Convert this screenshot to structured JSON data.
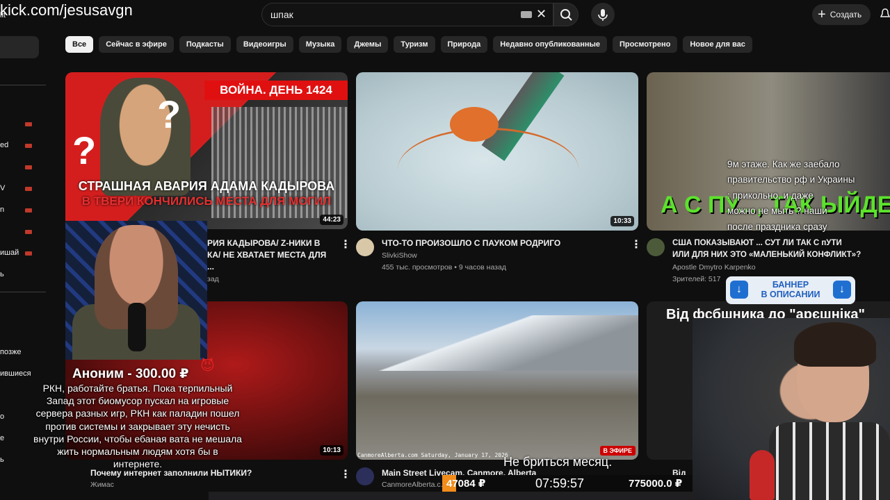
{
  "overlay": {
    "channel_url": "kick.com/jesusavgn",
    "donation_name": "Аноним - 300.00 ₽",
    "donation_text": "РКН, работайте братья. Пока терпильный Запад этот биомусор пускал на игровые сервера разных игр, РКН как паладин пошел против системы и закрывает эту нечисть внутри России, чтобы ебаная вата не мешала жить нормальным людям хотя бы в интернете.",
    "chat_lines": [
      "9м этаже. Как же заебало",
      "правительство рф и Украины",
      ": прикольно, и даже",
      "можно не мыть ? наши",
      "после праздника сразу"
    ],
    "banner": {
      "line1": "БАННЕР",
      "line2": "В ОПИСАНИИ"
    },
    "subtitle": "Не бриться месяц.",
    "ticker": {
      "left_value": "47084 ₽",
      "time": "07:59:57",
      "right_value": "775000.0 ₽"
    },
    "donation_icon": "devil-icon"
  },
  "header": {
    "search_query": "шпак",
    "create_label": "Создать",
    "icons": [
      "keyboard-icon",
      "clear-icon",
      "search-icon",
      "mic-icon",
      "plus-icon",
      "bell-icon"
    ]
  },
  "sidebar": {
    "items": [
      {
        "label": "lit"
      },
      {
        "label": "ed"
      },
      {
        "label": "V"
      },
      {
        "label": "n"
      },
      {
        "label": "ишай"
      },
      {
        "label": "ь"
      },
      {
        "label": "позже"
      },
      {
        "label": "ившиеся"
      },
      {
        "label": "о"
      },
      {
        "label": "е"
      },
      {
        "label": "ь"
      }
    ],
    "live_color": "#c0392b"
  },
  "chips": [
    "Все",
    "Сейчас в эфире",
    "Подкасты",
    "Видеоигры",
    "Музыка",
    "Джемы",
    "Туризм",
    "Природа",
    "Недавно опубликованные",
    "Просмотрено",
    "Новое для вас"
  ],
  "videos": [
    {
      "thumb_title_top": "ВОЙНА. ДЕНЬ 1424",
      "thumb_caption_1": "СТРАШНАЯ АВАРИЯ АДАМА КАДЫРОВА",
      "thumb_caption_2": "В ТВЕРИ КОНЧИЛИСЬ МЕСТА ДЛЯ МОГИЛ",
      "duration": "44:23",
      "title_line1": "РИЯ КАДЫРОВА/ Z-НИКИ В",
      "title_line2": "КА/ НЕ ХВАТАЕТ МЕСТА ДЛЯ ...",
      "meta": "зад"
    },
    {
      "duration": "10:33",
      "title": "ЧТО-ТО ПРОИЗОШЛО С ПАУКОМ РОДРИГО",
      "channel": "SlivkiShow",
      "meta": "455 тыс. просмотров • 9 часов назад"
    },
    {
      "thumb_text": "А С ПУ..., ТАК ЫЙДЕ",
      "title_line1": "США ПОКАЗЫВАЮТ ... СУТ ЛИ ТАК С пУТИ",
      "title_line2": "ИЛИ ДЛЯ НИХ ЭТО «МАЛЕНЬКИЙ КОНФЛИКТ»?",
      "channel": "Apostle Dmytro Karpenko",
      "meta": "Зрителей: 517"
    },
    {
      "duration": "10:13",
      "title": "Почему интернет заполнили НЫТИКИ?",
      "channel": "Жимас"
    },
    {
      "live_label": "В ЭФИРЕ",
      "cam_stamp": "CanmoreAlberta.com Saturday, January 17, 2026",
      "title": "Main Street Livecam, Canmore, Alberta",
      "channel": "CanmoreAlberta.c..."
    },
    {
      "thumb_head": "Від фсбшника до \"арєшніка\"",
      "title": "Від"
    }
  ]
}
